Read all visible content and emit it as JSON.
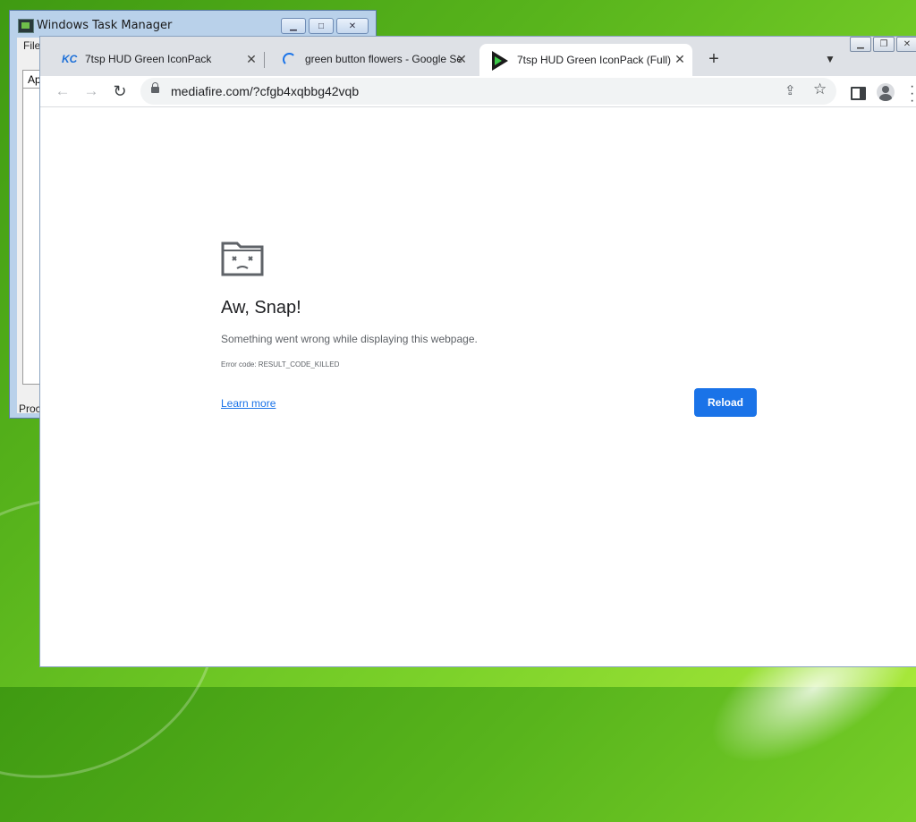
{
  "taskmgr": {
    "title": "Windows Task Manager",
    "menu_first": "File",
    "tab_first": "Ap",
    "status_first": "Proc"
  },
  "browser": {
    "tabs": [
      {
        "title": "7tsp HUD Green IconPack",
        "icon": "kc-favicon-icon",
        "active": false
      },
      {
        "title": "green button flowers - Google Se",
        "icon": "loading-spinner-icon",
        "active": false
      },
      {
        "title": "7tsp HUD Green IconPack (Full)",
        "icon": "hud-favicon-icon",
        "active": true
      }
    ],
    "new_tab": "+",
    "url": "mediafire.com/?cfgb4xqbbg42vqb"
  },
  "error_page": {
    "heading": "Aw, Snap!",
    "message": "Something went wrong while displaying this webpage.",
    "error_code": "Error code: RESULT_CODE_KILLED",
    "learn_more": "Learn more",
    "reload": "Reload"
  },
  "colors": {
    "accent": "#1a73e8",
    "desktop_green": "#58b41c",
    "tab_strip": "#dee1e6"
  }
}
